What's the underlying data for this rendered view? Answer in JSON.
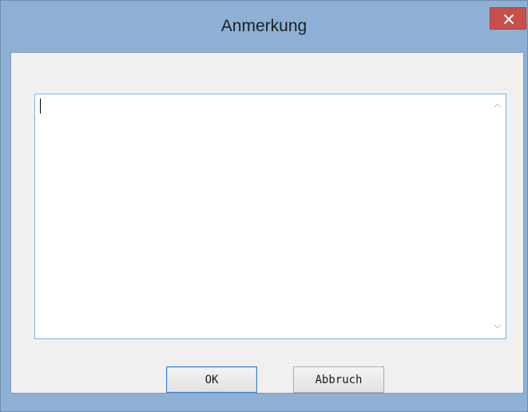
{
  "window": {
    "title": "Anmerkung"
  },
  "titlebar": {
    "close_icon": "close-icon"
  },
  "note": {
    "value": "",
    "scroll_up_icon": "chevron-up-icon",
    "scroll_down_icon": "chevron-down-icon"
  },
  "buttons": {
    "ok_label": "OK",
    "cancel_label": "Abbruch"
  },
  "colors": {
    "frame": "#8db0d4",
    "close_button": "#c7504a",
    "client": "#f0f0f0",
    "focus_border": "#3c7fd1"
  }
}
